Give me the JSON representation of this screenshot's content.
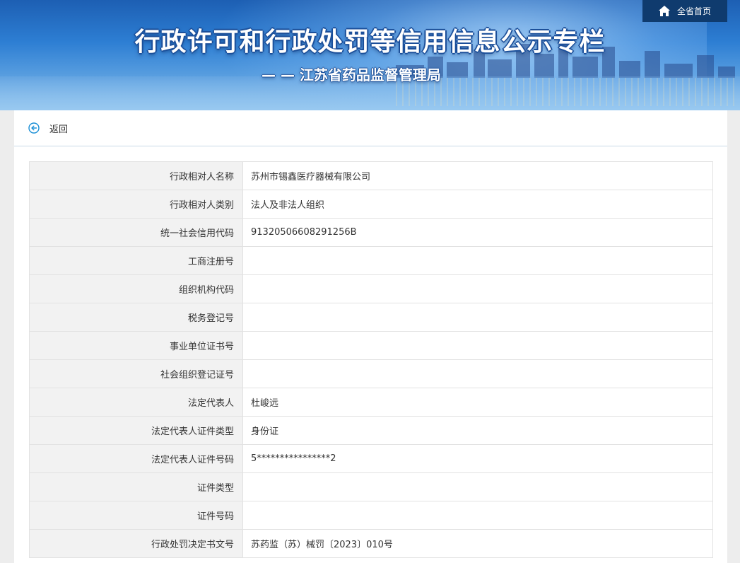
{
  "header": {
    "home_label": "全省首页",
    "title": "行政许可和行政处罚等信用信息公示专栏",
    "subtitle": "— — 江苏省药品监督管理局"
  },
  "nav": {
    "back_label": "返回"
  },
  "info_rows": [
    {
      "label": "行政相对人名称",
      "value": "苏州市锡鑫医疗器械有限公司"
    },
    {
      "label": "行政相对人类别",
      "value": "法人及非法人组织"
    },
    {
      "label": "统一社会信用代码",
      "value": "91320506608291256B"
    },
    {
      "label": "工商注册号",
      "value": ""
    },
    {
      "label": "组织机构代码",
      "value": ""
    },
    {
      "label": "税务登记号",
      "value": ""
    },
    {
      "label": "事业单位证书号",
      "value": ""
    },
    {
      "label": "社会组织登记证号",
      "value": ""
    },
    {
      "label": "法定代表人",
      "value": "杜峻远"
    },
    {
      "label": "法定代表人证件类型",
      "value": "身份证"
    },
    {
      "label": "法定代表人证件号码",
      "value": "5****************2"
    },
    {
      "label": "证件类型",
      "value": ""
    },
    {
      "label": "证件号码",
      "value": ""
    },
    {
      "label": "行政处罚决定书文号",
      "value": "苏药监（苏）械罚〔2023〕010号"
    }
  ],
  "colors": {
    "accent": "#1a8fd6",
    "home_bg": "#0f3b6e",
    "label_bg": "#f2f2f2"
  },
  "icons": {
    "home": "home-icon",
    "back": "back-arrow-circle-icon"
  }
}
